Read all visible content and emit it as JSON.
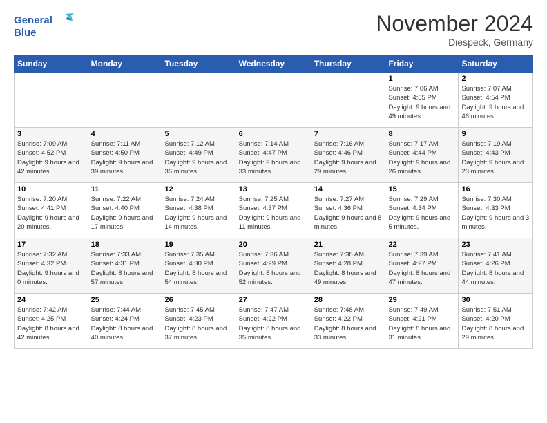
{
  "header": {
    "logo_line1": "General",
    "logo_line2": "Blue",
    "month_title": "November 2024",
    "location": "Diespeck, Germany"
  },
  "days_of_week": [
    "Sunday",
    "Monday",
    "Tuesday",
    "Wednesday",
    "Thursday",
    "Friday",
    "Saturday"
  ],
  "weeks": [
    [
      {
        "day": "",
        "info": ""
      },
      {
        "day": "",
        "info": ""
      },
      {
        "day": "",
        "info": ""
      },
      {
        "day": "",
        "info": ""
      },
      {
        "day": "",
        "info": ""
      },
      {
        "day": "1",
        "info": "Sunrise: 7:06 AM\nSunset: 4:55 PM\nDaylight: 9 hours and 49 minutes."
      },
      {
        "day": "2",
        "info": "Sunrise: 7:07 AM\nSunset: 4:54 PM\nDaylight: 9 hours and 46 minutes."
      }
    ],
    [
      {
        "day": "3",
        "info": "Sunrise: 7:09 AM\nSunset: 4:52 PM\nDaylight: 9 hours and 42 minutes."
      },
      {
        "day": "4",
        "info": "Sunrise: 7:11 AM\nSunset: 4:50 PM\nDaylight: 9 hours and 39 minutes."
      },
      {
        "day": "5",
        "info": "Sunrise: 7:12 AM\nSunset: 4:49 PM\nDaylight: 9 hours and 36 minutes."
      },
      {
        "day": "6",
        "info": "Sunrise: 7:14 AM\nSunset: 4:47 PM\nDaylight: 9 hours and 33 minutes."
      },
      {
        "day": "7",
        "info": "Sunrise: 7:16 AM\nSunset: 4:46 PM\nDaylight: 9 hours and 29 minutes."
      },
      {
        "day": "8",
        "info": "Sunrise: 7:17 AM\nSunset: 4:44 PM\nDaylight: 9 hours and 26 minutes."
      },
      {
        "day": "9",
        "info": "Sunrise: 7:19 AM\nSunset: 4:43 PM\nDaylight: 9 hours and 23 minutes."
      }
    ],
    [
      {
        "day": "10",
        "info": "Sunrise: 7:20 AM\nSunset: 4:41 PM\nDaylight: 9 hours and 20 minutes."
      },
      {
        "day": "11",
        "info": "Sunrise: 7:22 AM\nSunset: 4:40 PM\nDaylight: 9 hours and 17 minutes."
      },
      {
        "day": "12",
        "info": "Sunrise: 7:24 AM\nSunset: 4:38 PM\nDaylight: 9 hours and 14 minutes."
      },
      {
        "day": "13",
        "info": "Sunrise: 7:25 AM\nSunset: 4:37 PM\nDaylight: 9 hours and 11 minutes."
      },
      {
        "day": "14",
        "info": "Sunrise: 7:27 AM\nSunset: 4:36 PM\nDaylight: 9 hours and 8 minutes."
      },
      {
        "day": "15",
        "info": "Sunrise: 7:29 AM\nSunset: 4:34 PM\nDaylight: 9 hours and 5 minutes."
      },
      {
        "day": "16",
        "info": "Sunrise: 7:30 AM\nSunset: 4:33 PM\nDaylight: 9 hours and 3 minutes."
      }
    ],
    [
      {
        "day": "17",
        "info": "Sunrise: 7:32 AM\nSunset: 4:32 PM\nDaylight: 9 hours and 0 minutes."
      },
      {
        "day": "18",
        "info": "Sunrise: 7:33 AM\nSunset: 4:31 PM\nDaylight: 8 hours and 57 minutes."
      },
      {
        "day": "19",
        "info": "Sunrise: 7:35 AM\nSunset: 4:30 PM\nDaylight: 8 hours and 54 minutes."
      },
      {
        "day": "20",
        "info": "Sunrise: 7:36 AM\nSunset: 4:29 PM\nDaylight: 8 hours and 52 minutes."
      },
      {
        "day": "21",
        "info": "Sunrise: 7:38 AM\nSunset: 4:28 PM\nDaylight: 8 hours and 49 minutes."
      },
      {
        "day": "22",
        "info": "Sunrise: 7:39 AM\nSunset: 4:27 PM\nDaylight: 8 hours and 47 minutes."
      },
      {
        "day": "23",
        "info": "Sunrise: 7:41 AM\nSunset: 4:26 PM\nDaylight: 8 hours and 44 minutes."
      }
    ],
    [
      {
        "day": "24",
        "info": "Sunrise: 7:42 AM\nSunset: 4:25 PM\nDaylight: 8 hours and 42 minutes."
      },
      {
        "day": "25",
        "info": "Sunrise: 7:44 AM\nSunset: 4:24 PM\nDaylight: 8 hours and 40 minutes."
      },
      {
        "day": "26",
        "info": "Sunrise: 7:45 AM\nSunset: 4:23 PM\nDaylight: 8 hours and 37 minutes."
      },
      {
        "day": "27",
        "info": "Sunrise: 7:47 AM\nSunset: 4:22 PM\nDaylight: 8 hours and 35 minutes."
      },
      {
        "day": "28",
        "info": "Sunrise: 7:48 AM\nSunset: 4:22 PM\nDaylight: 8 hours and 33 minutes."
      },
      {
        "day": "29",
        "info": "Sunrise: 7:49 AM\nSunset: 4:21 PM\nDaylight: 8 hours and 31 minutes."
      },
      {
        "day": "30",
        "info": "Sunrise: 7:51 AM\nSunset: 4:20 PM\nDaylight: 8 hours and 29 minutes."
      }
    ]
  ]
}
